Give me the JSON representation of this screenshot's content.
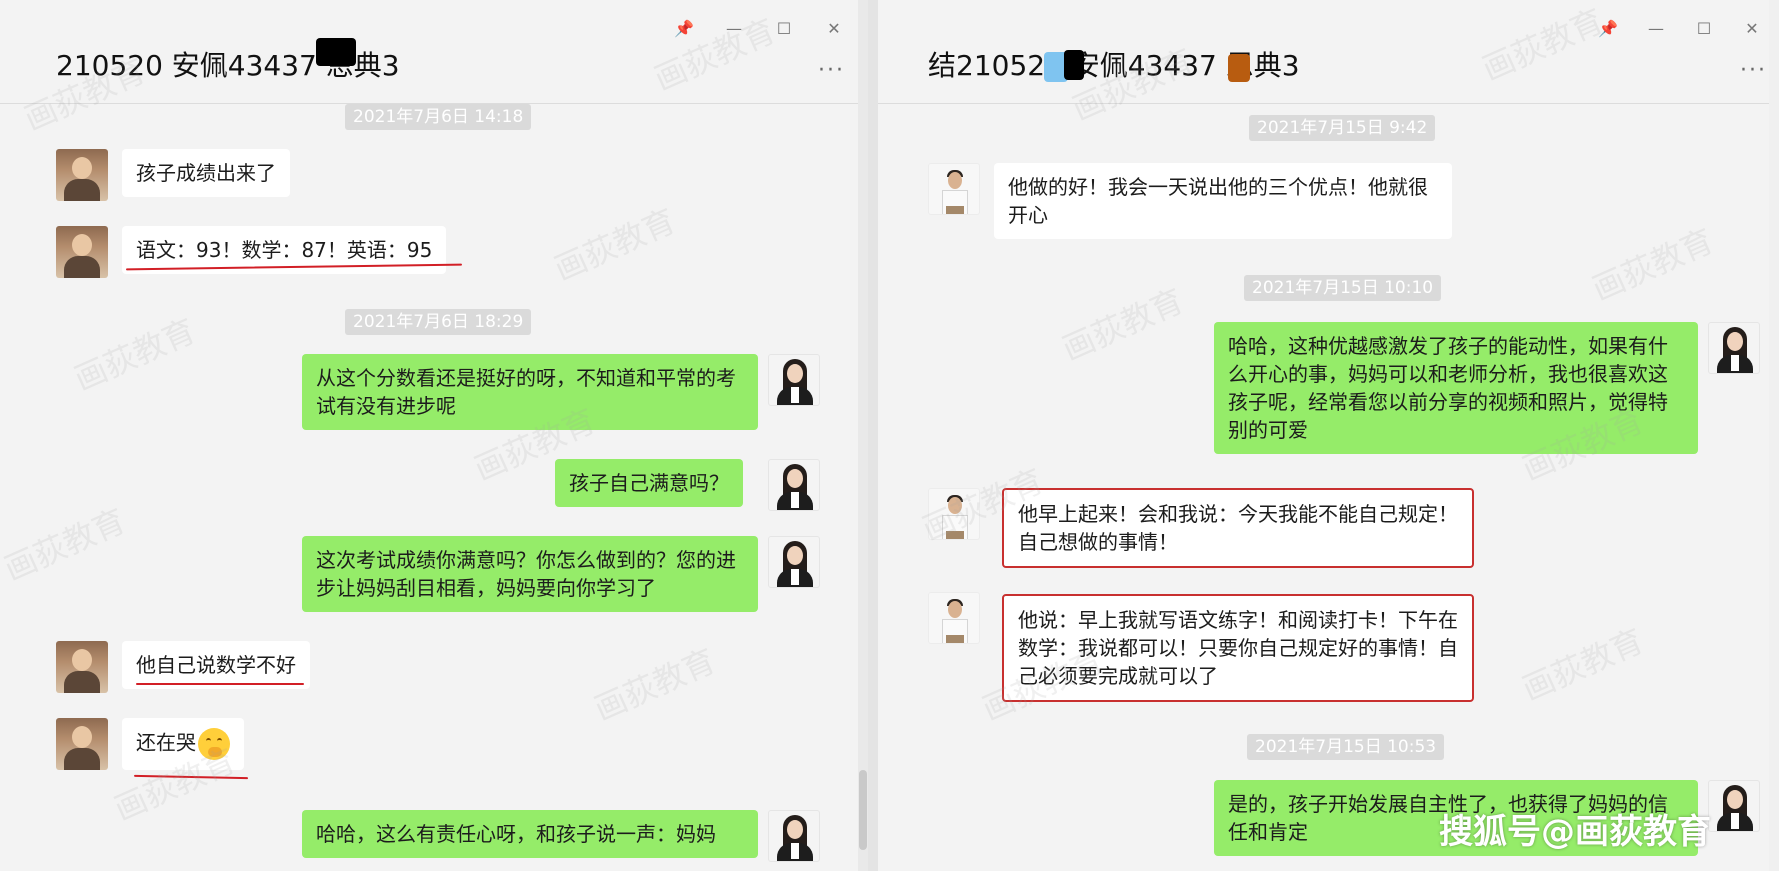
{
  "left_chat": {
    "title": "210520    安佩43437   恩典3",
    "controls": [
      "📌",
      "—",
      "☐",
      "✕"
    ],
    "more": "···",
    "timestamps": [
      "2021年7月6日 14:18",
      "2021年7月6日 18:29"
    ],
    "messages": [
      "孩子成绩出来了",
      "语文：93！数学：87！英语：95",
      "从这个分数看还是挺好的呀，不知道和平常的考试有没有进步呢",
      "孩子自己满意吗？",
      "这次考试成绩你满意吗？你怎么做到的？您的进步让妈妈刮目相看，妈妈要向你学习了",
      "他自己说数学不好",
      "还在哭",
      "哈哈，这么有责任心呀，和孩子说一声：妈妈"
    ]
  },
  "right_chat": {
    "title": "结210520    安佩43437    恩典3",
    "controls": [
      "📌",
      "—",
      "☐",
      "✕"
    ],
    "more": "···",
    "timestamps": [
      "2021年7月15日 9:42",
      "2021年7月15日 10:10",
      "2021年7月15日 10:53"
    ],
    "messages": [
      "他做的好！我会一天说出他的三个优点！他就很开心",
      "哈哈，这种优越感激发了孩子的能动性，如果有什么开心的事，妈妈可以和老师分析，我也很喜欢这孩子呢，经常看您以前分享的视频和照片，觉得特别的可爱",
      "他早上起来！会和我说：今天我能不能自己规定！自己想做的事情！",
      "他说：早上我就写语文练字！和阅读打卡！下午在数学：我说都可以！只要你自己规定好的事情！自己必须要完成就可以了",
      "是的，孩子开始发展自主性了，也获得了妈妈的信任和肯定"
    ]
  },
  "watermark": "画荻教育",
  "source_credit": "搜狐号@画荻教育",
  "colors": {
    "outgoing_bubble": "#95ec69",
    "incoming_bubble": "#ffffff",
    "highlight_red": "#c8302f",
    "timestamp_bg": "#dadada"
  }
}
